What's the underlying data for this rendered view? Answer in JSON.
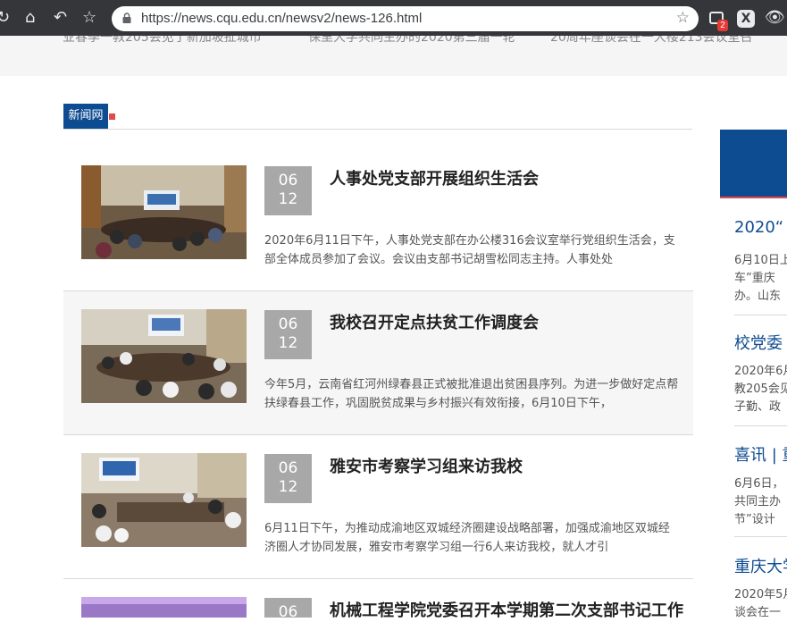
{
  "browser": {
    "url": "https://news.cqu.edu.cn/newsv2/news-126.html",
    "extension_badge": "2",
    "extension2_label": "X"
  },
  "ticker": [
    "业春季一教205会见了新加坡扯城市",
    "保里大学共同主办的2020第三届一轮",
    "20周年座谈会在一大楼213会议室召"
  ],
  "section": {
    "tag": "新闻网"
  },
  "news": [
    {
      "month": "06",
      "day": "12",
      "title": "人事处党支部开展组织生活会",
      "summary": "2020年6月11日下午，人事处党支部在办公楼316会议室举行党组织生活会，支部全体成员参加了会议。会议由支部书记胡雪松同志主持。人事处处"
    },
    {
      "month": "06",
      "day": "12",
      "title": "我校召开定点扶贫工作调度会",
      "summary": "今年5月，云南省红河州绿春县正式被批准退出贫困县序列。为进一步做好定点帮扶绿春县工作，巩固脱贫成果与乡村振兴有效衔接，6月10日下午，"
    },
    {
      "month": "06",
      "day": "12",
      "title": "雅安市考察学习组来访我校",
      "summary": "6月11日下午，为推动成渝地区双城经济圈建设战略部署，加强成渝地区双城经济圈人才协同发展，雅安市考察学习组一行6人来访我校，就人才引"
    },
    {
      "month": "06",
      "day": "",
      "title": "机械工程学院党委召开本学期第二次支部书记工作",
      "summary": ""
    }
  ],
  "sidebar": [
    {
      "title": "2020“",
      "lines": [
        "6月10日上",
        "车”重庆",
        "办。山东"
      ]
    },
    {
      "title": "校党委",
      "lines": [
        "2020年6月",
        "教205会见",
        "子勤、政"
      ]
    },
    {
      "title": "喜讯 | 重",
      "lines": [
        "6月6日，",
        "共同主办",
        "节”设计"
      ]
    },
    {
      "title": "重庆大学",
      "lines": [
        "2020年5月",
        "谈会在一"
      ]
    }
  ]
}
